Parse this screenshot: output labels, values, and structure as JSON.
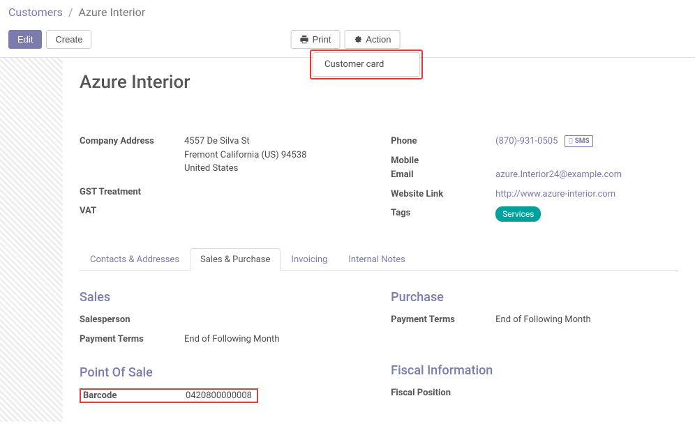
{
  "breadcrumb": {
    "root": "Customers",
    "current": "Azure Interior"
  },
  "toolbar": {
    "edit": "Edit",
    "create": "Create",
    "print": "Print",
    "action": "Action",
    "dropdown_item": "Customer card"
  },
  "record": {
    "title": "Azure Interior",
    "left": {
      "company_address_label": "Company Address",
      "address_line1": "4557 De Silva St",
      "address_line2": "Fremont  California (US)  94538",
      "address_country": "United States",
      "gst_label": "GST Treatment",
      "vat_label": "VAT"
    },
    "right": {
      "phone_label": "Phone",
      "phone_value": "(870)-931-0505",
      "sms": "SMS",
      "mobile_label": "Mobile",
      "email_label": "Email",
      "email_value": "azure.Interior24@example.com",
      "website_label": "Website Link",
      "website_value": "http://www.azure-interior.com",
      "tags_label": "Tags",
      "tags_value": "Services"
    }
  },
  "tabs": {
    "contacts": "Contacts & Addresses",
    "sales": "Sales & Purchase",
    "invoicing": "Invoicing",
    "notes": "Internal Notes"
  },
  "sales_purchase": {
    "sales_title": "Sales",
    "salesperson_label": "Salesperson",
    "payment_terms_label": "Payment Terms",
    "payment_terms_value": "End of Following Month",
    "pos_title": "Point Of Sale",
    "barcode_label": "Barcode",
    "barcode_value": "0420800000008",
    "purchase_title": "Purchase",
    "purchase_payment_terms_label": "Payment Terms",
    "purchase_payment_terms_value": "End of Following Month",
    "fiscal_title": "Fiscal Information",
    "fiscal_position_label": "Fiscal Position"
  }
}
